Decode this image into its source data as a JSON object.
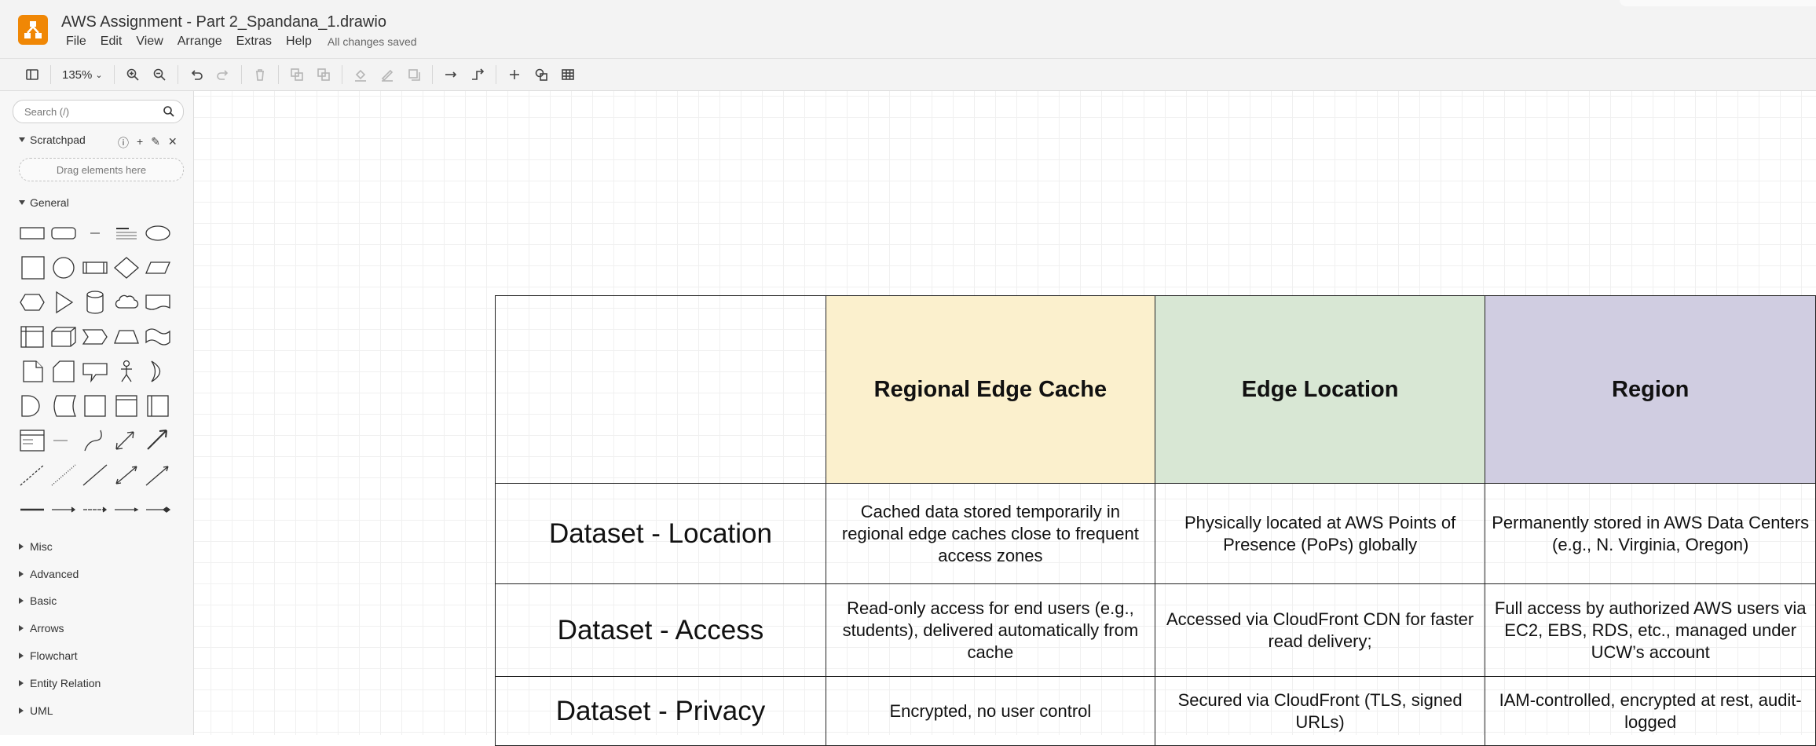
{
  "app": {
    "title": "AWS Assignment - Part 2_Spandana_1.drawio",
    "save_status": "All changes saved"
  },
  "menu": [
    "File",
    "Edit",
    "View",
    "Arrange",
    "Extras",
    "Help"
  ],
  "toolbar": {
    "zoom": "135%"
  },
  "sidebar": {
    "search_placeholder": "Search (/)",
    "scratchpad": {
      "title": "Scratchpad",
      "drop_hint": "Drag elements here"
    },
    "general_title": "General",
    "sections": [
      "Misc",
      "Advanced",
      "Basic",
      "Arrows",
      "Flowchart",
      "Entity Relation",
      "UML"
    ]
  },
  "diagram": {
    "columns": [
      "Regional Edge Cache",
      "Edge Location",
      "Region"
    ],
    "colors": {
      "regional_edge_cache": "#fbf0cd",
      "edge_location": "#d8e7d4",
      "region": "#d0cde1"
    },
    "rows": [
      {
        "label": "Dataset - Location",
        "cells": [
          "Cached data stored temporarily in regional edge caches close to frequent access zones",
          "Physically located at AWS Points of Presence (PoPs) globally",
          "Permanently stored in AWS Data Centers (e.g., N. Virginia, Oregon)"
        ]
      },
      {
        "label": "Dataset - Access",
        "cells": [
          "Read-only access for end users (e.g., students), delivered automatically from cache",
          "Accessed via CloudFront CDN for faster read delivery;",
          "Full access by authorized AWS users via EC2, EBS, RDS, etc., managed under UCW’s account"
        ]
      },
      {
        "label": "Dataset - Privacy",
        "cells": [
          "Encrypted, no user control",
          "Secured via CloudFront (TLS, signed URLs)",
          "IAM-controlled, encrypted at rest, audit-logged"
        ]
      }
    ]
  }
}
